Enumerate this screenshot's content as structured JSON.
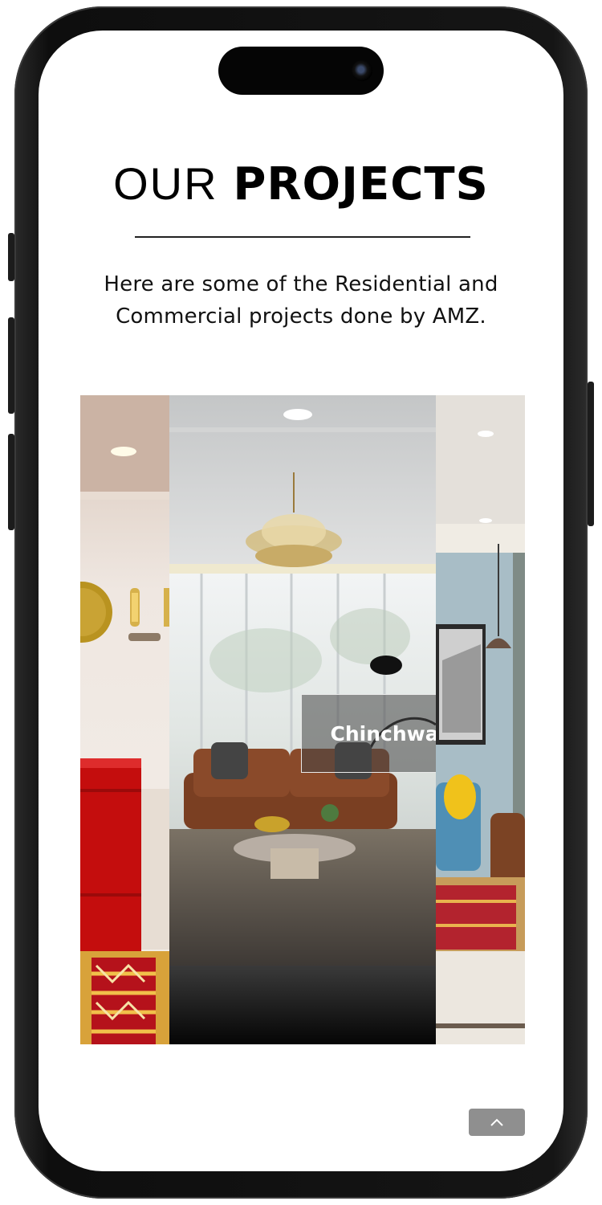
{
  "header": {
    "title_light": "OUR",
    "title_bold": "PROJECTS",
    "description": "Here are some of the Residential and Commercial projects done by AMZ."
  },
  "gallery": {
    "slides": [
      {
        "caption": ""
      },
      {
        "caption": "Chinchwad"
      },
      {
        "caption": ""
      }
    ],
    "active_caption": "Chinchwad"
  },
  "controls": {
    "scroll_top_icon": "chevron-up-icon"
  },
  "colors": {
    "accent_red": "#c40d0d",
    "scroll_button": "#8f8f8f",
    "text": "#111111"
  }
}
